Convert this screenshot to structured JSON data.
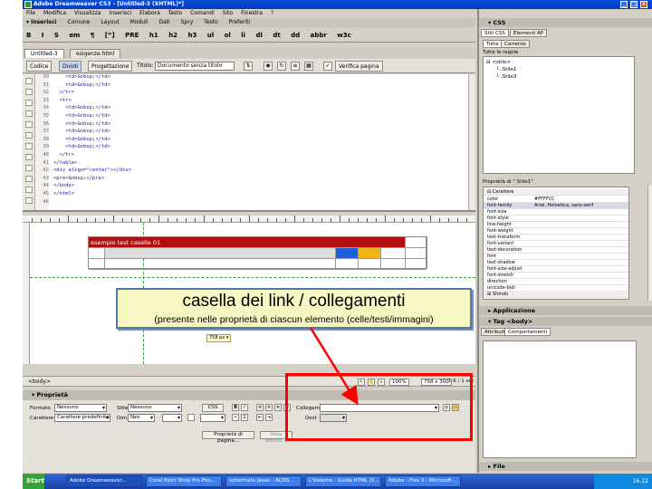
{
  "window": {
    "title": "Adobe Dreamweaver CS3 - [Untitled-3 (XHTML)*]",
    "buttons": [
      "_",
      "□",
      "x"
    ]
  },
  "menu": [
    "File",
    "Modifica",
    "Visualizza",
    "Inserisci",
    "Elabora",
    "Testo",
    "Comandi",
    "Sito",
    "Finestra",
    "?"
  ],
  "insert_bar": {
    "tabs": [
      "▾ Inserisci",
      "Comune",
      "Layout",
      "Moduli",
      "Dati",
      "Spry",
      "Testo",
      "Preferiti"
    ],
    "tools": [
      "B",
      "I",
      "S",
      "em",
      "¶",
      "[“]",
      "PRE",
      "h1",
      "h2",
      "h3",
      "ul",
      "ol",
      "li",
      "dl",
      "dt",
      "dd",
      "abbr",
      "w3c"
    ]
  },
  "doc_tabs": [
    "Untitled-3",
    "esigenze.html"
  ],
  "doc_toolbar": {
    "code_btn": "Codice",
    "split_btn": "Dividi",
    "design_btn": "Progettazione",
    "title_label": "Titolo:",
    "title_value": "Documento senza titolo",
    "check_btn": "Verifica pagina"
  },
  "code": {
    "line_numbers": [
      "30",
      "31",
      "32",
      "33",
      "34",
      "35",
      "36",
      "37",
      "38",
      "39",
      "40",
      "41",
      "42",
      "43",
      "44",
      "45",
      "46"
    ],
    "lines": [
      "    <td>&nbsp;</td>",
      "    <td>&nbsp;</td>",
      "  </tr>",
      "  <tr>",
      "    <td>&nbsp;</td>",
      "    <td>&nbsp;</td>",
      "    <td>&nbsp;</td>",
      "    <td>&nbsp;</td>",
      "    <td>&nbsp;</td>",
      "    <td>&nbsp;</td>",
      "  </tr>",
      "</table>",
      "<div align=\"center\"></div>",
      "<pre>&nbsp;</pre>",
      "</body>",
      "</html>",
      ""
    ]
  },
  "design": {
    "table_caption": "esempio test caselle 01",
    "size_tag": "758 px ▾",
    "cell_colors": {
      "blue": "#1f5fd8",
      "yellow": "#f2b414",
      "red": "#b01010"
    }
  },
  "callout": {
    "title": "casella dei link / collegamenti",
    "subtitle": "(presente nelle proprietà di ciascun elemento (celle/testi/immagini)"
  },
  "status": {
    "tag": "<body>",
    "zoom": "100%",
    "size": "758 x 300",
    "weight": "1 K / 1 sec"
  },
  "properties": {
    "header": "▾ Proprietà",
    "formato_label": "Formato",
    "formato_value": "Nessuno",
    "stile_label": "Stile",
    "stile_value": "Nessuno",
    "carattere_label": "Carattere",
    "carattere_value": "Carattere predefinito",
    "dim_label": "Dim.",
    "dim_value": "Nes",
    "css_btn": "CSS",
    "collegam_label": "Collegam",
    "dest_label": "Dest",
    "page_props_btn": "Proprietà di pagina...",
    "list_btn": "Voce elenco..."
  },
  "css_panel": {
    "header": "▾ CSS",
    "tabs": [
      "Stili CSS",
      "Elementi AP"
    ],
    "subtabs": [
      "Tutte",
      "Corrente"
    ],
    "rules_title": "Tutte le regole",
    "rules": [
      "⊟ <stile>",
      "└ .Stile1",
      "└ .Stile3"
    ],
    "props_title": "Proprietà di \".Stile1\"",
    "group_label": "⊟ Carattere",
    "props": [
      {
        "name": "color",
        "value": "#FFFFCC"
      },
      {
        "name": "font-family",
        "value": "Arial, Helvetica, sans-serif"
      },
      {
        "name": "font-size",
        "value": ""
      },
      {
        "name": "font-style",
        "value": ""
      },
      {
        "name": "line-height",
        "value": ""
      },
      {
        "name": "font-weight",
        "value": ""
      },
      {
        "name": "text-transform",
        "value": ""
      },
      {
        "name": "font-variant",
        "value": ""
      },
      {
        "name": "text-decoration",
        "value": ""
      },
      {
        "name": "font",
        "value": ""
      },
      {
        "name": "text-shadow",
        "value": ""
      },
      {
        "name": "font-size-adjust",
        "value": ""
      },
      {
        "name": "font-stretch",
        "value": ""
      },
      {
        "name": "direction",
        "value": ""
      },
      {
        "name": "unicode-bidi",
        "value": ""
      }
    ],
    "sfondo_label": "⊞ Sfondo"
  },
  "application_panel": {
    "header": "▸ Applicazione"
  },
  "tag_panel": {
    "header": "▾ Tag <body>",
    "tabs": [
      "Attributi",
      "Comportamenti"
    ]
  },
  "files_panel": {
    "header": "▸ File"
  },
  "taskbar": {
    "start": "Start",
    "tasks": [
      "Adobe Dreamweaver...",
      "Corel Paint Shop Pro Pho...",
      "schermate Jasan - ACDS...",
      "L'Insieme - Guida HTML (X...",
      "Adobe - Flex 3 - Microsoft ..."
    ],
    "clock": "16.22"
  }
}
